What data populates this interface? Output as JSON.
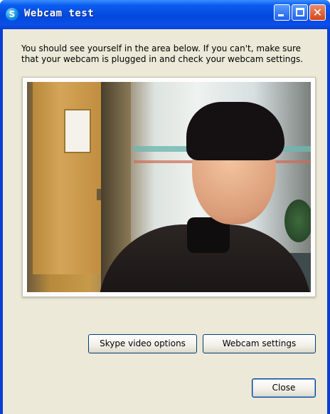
{
  "window": {
    "title": "Webcam test",
    "title_icon_glyph": "S",
    "title_icon": "skype-icon",
    "controls": {
      "minimize": "minimize-icon",
      "maximize": "maximize-icon",
      "close": "close-icon",
      "close_glyph": "✕"
    }
  },
  "content": {
    "instructions": "You should see yourself in the area below. If you can't, make sure that your webcam is plugged in and check your webcam settings."
  },
  "buttons": {
    "skype_video_options": "Skype video options",
    "webcam_settings": "Webcam settings",
    "close": "Close"
  },
  "colors": {
    "titlebar": "#0a4fe8",
    "dialog_background": "#ece9d8",
    "button_border": "#003c74"
  }
}
